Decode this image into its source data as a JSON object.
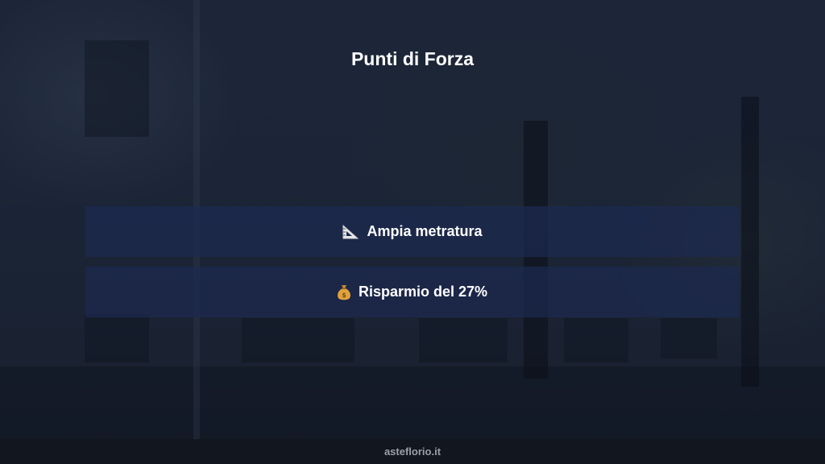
{
  "slide": {
    "title": "Punti di Forza"
  },
  "points": [
    {
      "icon": "triangular-ruler-icon",
      "label": "Ampia metratura"
    },
    {
      "icon": "money-bag-icon",
      "label": "Risparmio del 27%"
    }
  ],
  "footer": {
    "site": "asteflorio.it"
  },
  "colors": {
    "background": "#1a2336",
    "card": "#1d2a50",
    "text": "#ffffff",
    "footer_bg": "#12161e",
    "footer_text": "#9aa0a8"
  }
}
